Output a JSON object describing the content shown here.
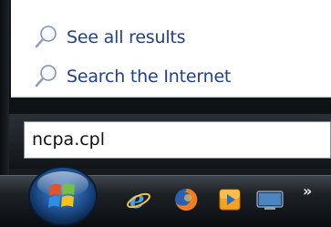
{
  "search_results": {
    "items": [
      {
        "label": "See all results",
        "icon": "search-icon"
      },
      {
        "label": "Search the Internet",
        "icon": "search-icon"
      }
    ]
  },
  "search_box": {
    "value": "ncpa.cpl"
  },
  "taskbar": {
    "start_button": "windows-logo-icon",
    "quick_launch": [
      "internet-explorer-icon",
      "firefox-icon",
      "media-player-icon",
      "show-desktop-icon"
    ],
    "overflow_label": "»"
  },
  "colors": {
    "result_text": "#1f3f8f",
    "search_text": "#111111",
    "taskbar_dark": "#0a0d10"
  }
}
